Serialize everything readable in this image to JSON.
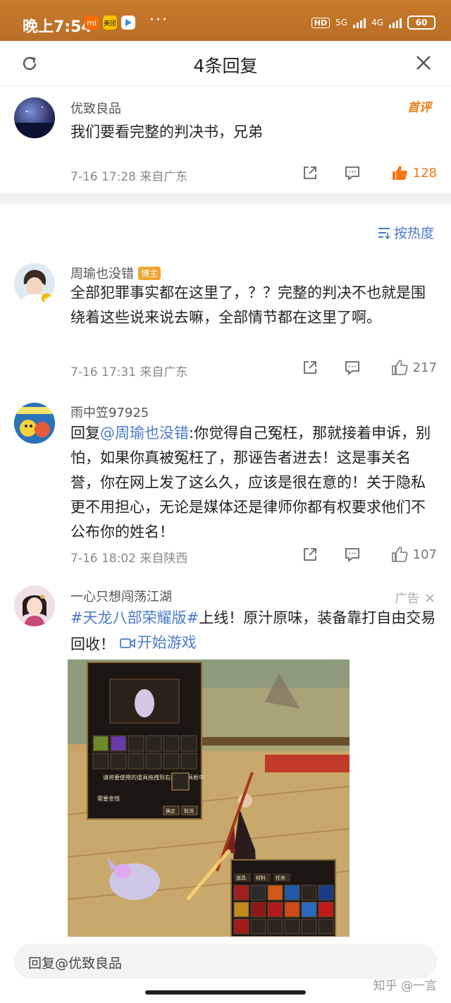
{
  "status_bar": {
    "time": "晚上7:54",
    "app_icons": [
      "mi",
      "美团",
      "play"
    ],
    "dots": "···",
    "hd": "HD",
    "net1": "5G",
    "net2": "4G",
    "battery": "60"
  },
  "sheet": {
    "title": "4条回复"
  },
  "root_comment": {
    "username": "优致良品",
    "tag": "首评",
    "text": "我们要看完整的判决书，兄弟",
    "time_loc": "7-16 17:28 来自广东",
    "likes": "128"
  },
  "sort_label": "按热度",
  "replies": [
    {
      "username": "周瑜也没错",
      "badge": "博主",
      "text": "全部犯罪事实都在这里了，？？完整的判决不也就是围绕着这些说来说去嘛，全部情节都在这里了啊。",
      "time_loc": "7-16 17:31 来自广东",
      "likes": "217"
    },
    {
      "username": "雨中笠97925",
      "reply_prefix": "回复",
      "mention": "@周瑜也没错",
      "text": ":你觉得自己冤枉，那就接着申诉，别怕，如果你真被冤枉了，那诬告者进去！这是事关名誉，你在网上发了这么久，应该是很在意的！关于隐私更不用担心，无论是媒体还是律师你都有权要求他们不公布你的姓名！",
      "time_loc": "7-16 18:02 来自陕西",
      "likes": "107"
    }
  ],
  "ad": {
    "username": "一心只想闯荡江湖",
    "ad_label": "广告",
    "topic": "#天龙八部荣耀版#",
    "text": "上线！原汁原味，装备靠打自由交易回收！",
    "cta": "开始游戏",
    "game_labels": {
      "hint": "请将要使用的道具拖拽到右边的道具框中",
      "cost": "需要金钱",
      "confirm": "确定",
      "cancel": "取消",
      "tab1": "道具",
      "tab2": "材料",
      "tab3": "任务"
    }
  },
  "reply_input": {
    "placeholder": "回复@优致良品"
  },
  "watermark": "知乎 @一言"
}
